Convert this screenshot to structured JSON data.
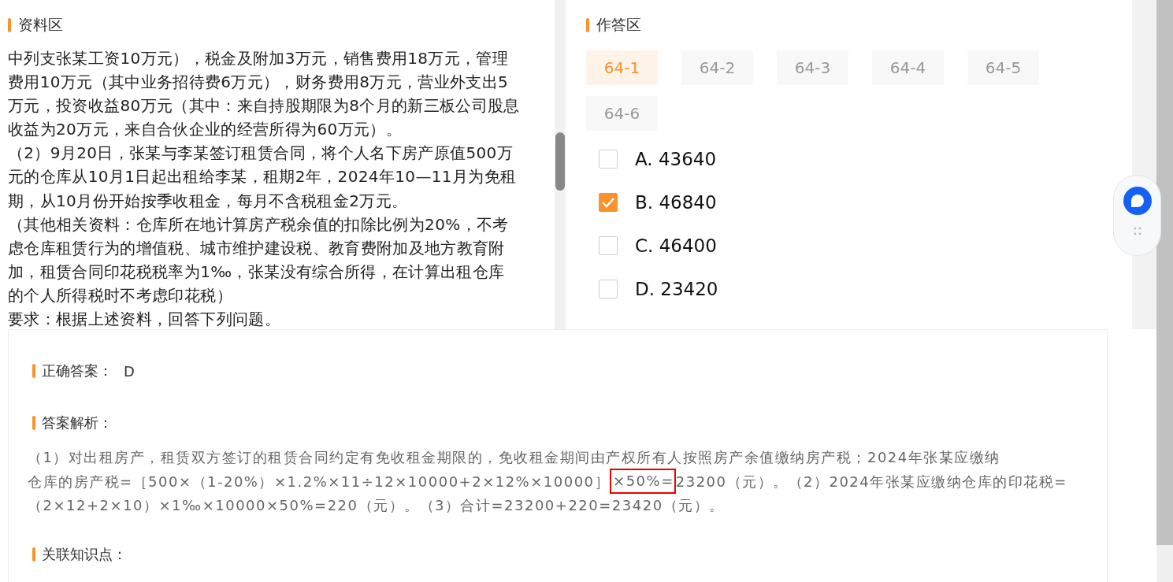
{
  "material": {
    "title": "资料区",
    "lines": [
      "中列支张某工资10万元），税金及附加3万元，销售费用18万元，管理",
      "费用10万元（其中业务招待费6万元），财务费用8万元，营业外支出5",
      "万元，投资收益80万元（其中：来自持股期限为8个月的新三板公司股息",
      "收益为20万元，来自合伙企业的经营所得为60万元）。",
      "（2）9月20日，张某与李某签订租赁合同，将个人名下房产原值500万",
      "元的仓库从10月1日起出租给李某，租期2年，2024年10—11月为免租",
      "期，从10月份开始按季收租金，每月不含税租金2万元。",
      "（其他相关资料：仓库所在地计算房产税余值的扣除比例为20%，不考",
      "虑仓库租赁行为的增值税、城市维护建设税、教育费附加及地方教育附",
      "加，租赁合同印花税税率为1‰，张某没有综合所得，在计算出租仓库",
      "的个人所得税时不考虑印花税）",
      "要求：根据上述资料，回答下列问题。"
    ]
  },
  "answer_area": {
    "title": "作答区",
    "tabs": [
      {
        "label": "64-1",
        "selected": true
      },
      {
        "label": "64-2",
        "selected": false
      },
      {
        "label": "64-3",
        "selected": false
      },
      {
        "label": "64-4",
        "selected": false
      },
      {
        "label": "64-5",
        "selected": false
      },
      {
        "label": "64-6",
        "selected": false
      }
    ],
    "options": [
      {
        "label": "A. 43640",
        "checked": false
      },
      {
        "label": "B. 46840",
        "checked": true
      },
      {
        "label": "C. 46400",
        "checked": false
      },
      {
        "label": "D. 23420",
        "checked": false
      }
    ]
  },
  "result": {
    "correct_label": "正确答案：",
    "correct_value": "D",
    "analysis_label": "答案解析：",
    "analysis_lines": [
      "（1）对出租房产，租赁双方签订的租赁合同约定有免收租金期限的，免收租金期间由产权所有人按照房产余值缴纳房产税；2024年张某应缴纳",
      {
        "before": "仓库的房产税=［500×（1-20%）×1.2%×11÷12×10000+2×12%×10000］",
        "highlighted": "×50%=",
        "after": "23200（元）。（2）2024年张某应缴纳仓库的印花税="
      },
      "（2×12+2×10）×1‰×10000×50%=220（元）。（3）合计=23200+220=23420（元）。"
    ],
    "knowledge_label": "关联知识点："
  }
}
